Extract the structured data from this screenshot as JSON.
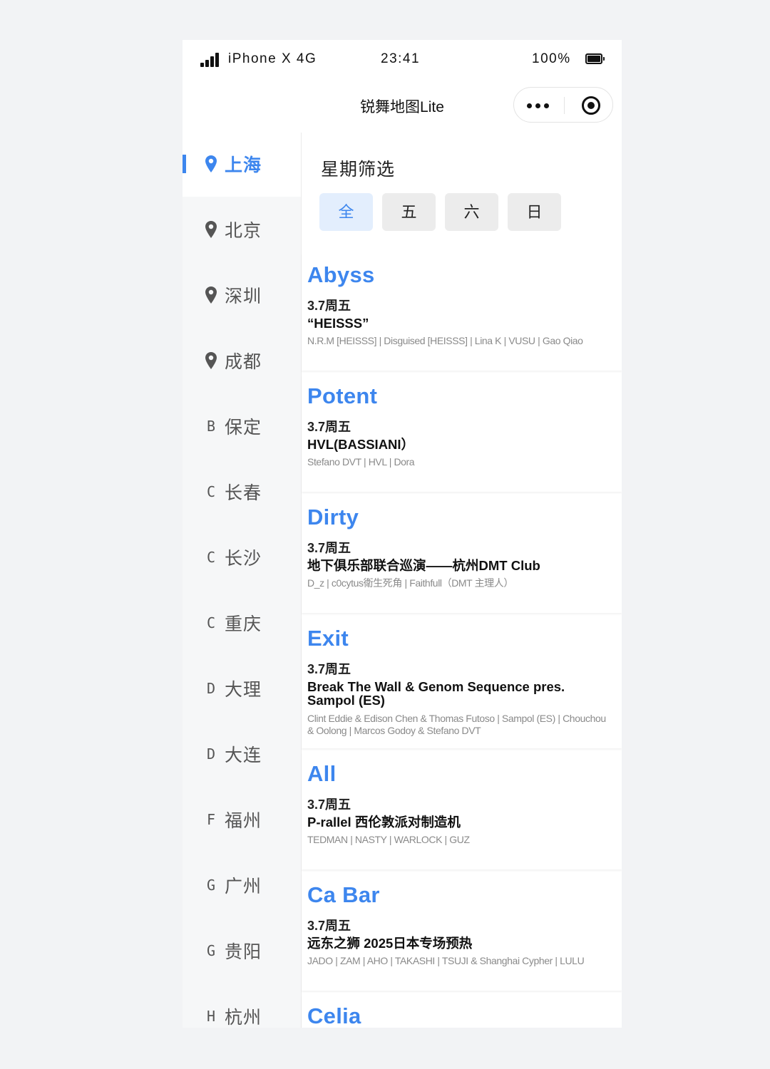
{
  "status_bar": {
    "carrier": "iPhone X  4G",
    "time": "23:41",
    "battery": "100%"
  },
  "nav": {
    "title": "锐舞地图Lite"
  },
  "sidebar": {
    "accent_color": "#3d86ee",
    "cities": [
      {
        "icon": "pin",
        "label": "上海",
        "active": true
      },
      {
        "icon": "pin",
        "label": "北京"
      },
      {
        "icon": "pin",
        "label": "深圳"
      },
      {
        "icon": "pin",
        "label": "成都"
      },
      {
        "letter": "B",
        "label": "保定"
      },
      {
        "letter": "C",
        "label": "长春"
      },
      {
        "letter": "C",
        "label": "长沙"
      },
      {
        "letter": "C",
        "label": "重庆"
      },
      {
        "letter": "D",
        "label": "大理"
      },
      {
        "letter": "D",
        "label": "大连"
      },
      {
        "letter": "F",
        "label": "福州"
      },
      {
        "letter": "G",
        "label": "广州"
      },
      {
        "letter": "G",
        "label": "贵阳"
      },
      {
        "letter": "H",
        "label": "杭州"
      }
    ]
  },
  "filter": {
    "title": "星期筛选",
    "options": [
      "全",
      "五",
      "六",
      "日"
    ],
    "selected": "全"
  },
  "events": [
    {
      "venue": "Abyss",
      "date": "3.7周五",
      "title": "“HEISSS”",
      "lineup": "N.R.M [HEISSS] | Disguised [HEISSS] | Lina K | VUSU | Gao Qiao"
    },
    {
      "venue": "Potent",
      "date": "3.7周五",
      "title": "HVL(BASSIANI）",
      "lineup": "Stefano DVT | HVL | Dora"
    },
    {
      "venue": "Dirty",
      "date": "3.7周五",
      "title": "地下俱乐部联合巡演——杭州DMT Club",
      "lineup": "D_z | c0cytus衛生死角 | Faithfull（DMT 主理人）"
    },
    {
      "venue": "Exit",
      "date": "3.7周五",
      "title": "Break The Wall & Genom Sequence pres. Sampol (ES)",
      "lineup": "Clint Eddie & Edison Chen & Thomas Futoso | Sampol (ES) | Chouchou & Oolong | Marcos Godoy & Stefano DVT"
    },
    {
      "venue": "All",
      "date": "3.7周五",
      "title": "P-rallel 西伦敦派对制造机",
      "lineup": "TEDMAN | NASTY | WARLOCK | GUZ"
    },
    {
      "venue": "Ca Bar",
      "date": "3.7周五",
      "title": "远东之狮 2025日本专场预热",
      "lineup": "JADO | ZAM | AHO | TAKASHI | TSUJI & Shanghai Cypher | LULU"
    },
    {
      "venue": "Celia",
      "date": "",
      "title": "",
      "lineup": ""
    }
  ]
}
